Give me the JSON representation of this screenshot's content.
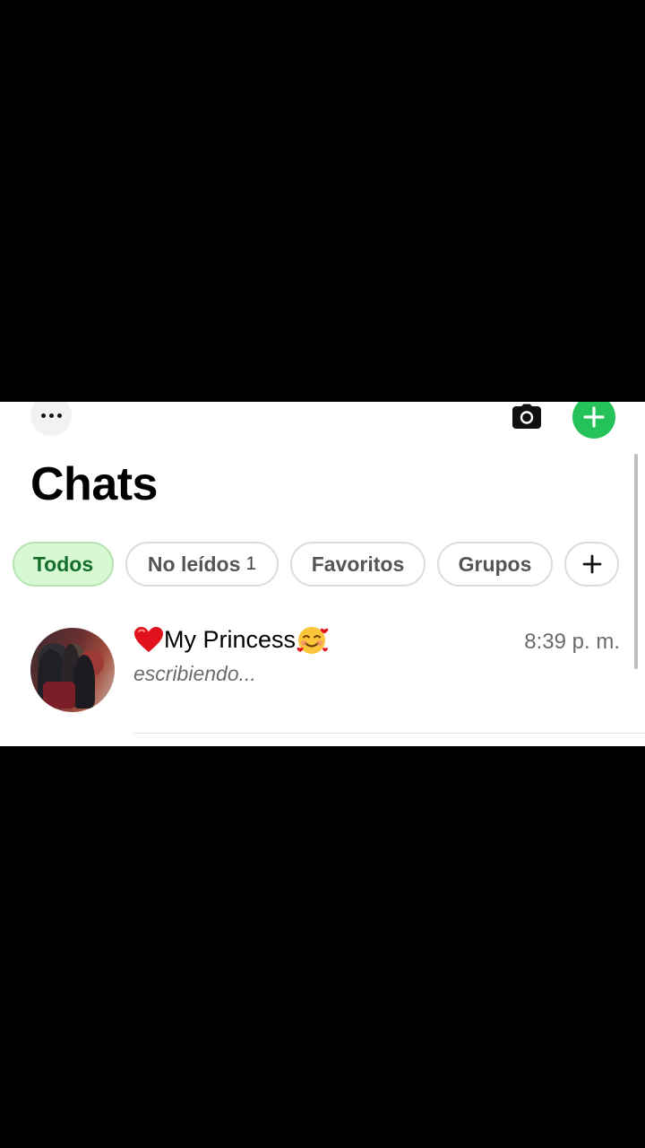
{
  "header": {
    "more_icon": "ellipsis-icon",
    "camera_icon": "camera-icon",
    "new_chat_icon": "plus-icon",
    "title": "Chats"
  },
  "filters": [
    {
      "label": "Todos",
      "active": true
    },
    {
      "label": "No leídos",
      "count": "1",
      "active": false
    },
    {
      "label": "Favoritos",
      "active": false
    },
    {
      "label": "Grupos",
      "active": false
    }
  ],
  "add_filter_icon": "plus-icon",
  "chats": [
    {
      "name": "My Princess",
      "prefix_emoji": "red-heart-icon",
      "suffix_emoji": "smiling-face-with-hearts-icon",
      "time": "8:39 p. m.",
      "preview": "escribiendo..."
    }
  ],
  "colors": {
    "accent": "#25c25a",
    "active_chip_bg": "#d6f8d3",
    "active_chip_text": "#146d2b"
  }
}
